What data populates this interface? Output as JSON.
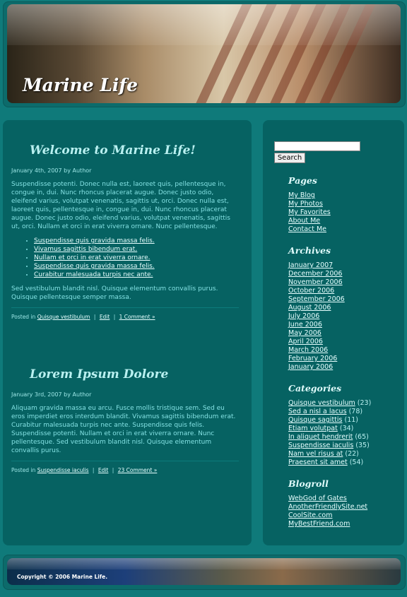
{
  "site": {
    "title": "Marine Life"
  },
  "search": {
    "button_label": "Search",
    "value": ""
  },
  "posts": [
    {
      "title": "Welcome to Marine Life!",
      "meta": "January 4th, 2007 by Author",
      "body_intro": "Suspendisse potenti. Donec nulla est, laoreet quis, pellentesque in, congue in, dui. Nunc rhoncus placerat augue. Donec justo odio, eleifend varius, volutpat venenatis, sagittis ut, orci. Donec nulla est, laoreet quis, pellentesque in, congue in, dui. Nunc rhoncus placerat augue. Donec justo odio, eleifend varius, volutpat venenatis, sagittis ut, orci. Nullam et orci in erat viverra ornare. Nunc pellentesque.",
      "list": [
        "Suspendisse quis gravida massa felis.",
        "Vivamus sagittis bibendum erat.",
        "Nullam et orci in erat viverra ornare.",
        "Suspendisse quis gravida massa felis.",
        "Curabitur malesuada turpis nec ante."
      ],
      "body_outro": "Sed vestibulum blandit nisl. Quisque elementum convallis purus. Quisque pellentesque semper massa.",
      "posted_in_label": "Posted in",
      "category": "Quisque vestibulum",
      "edit_label": "Edit",
      "comments_label": "1 Comment »"
    },
    {
      "title": "Lorem Ipsum Dolore",
      "meta": "January 3rd, 2007 by Author",
      "body_intro": "Aliquam gravida massa eu arcu. Fusce mollis tristique sem. Sed eu eros imperdiet eros interdum blandit. Vivamus sagittis bibendum erat. Curabitur malesuada turpis nec ante. Suspendisse quis felis. Suspendisse potenti. Nullam et orci in erat viverra ornare. Nunc pellentesque. Sed vestibulum blandit nisl. Quisque elementum convallis purus.",
      "posted_in_label": "Posted in",
      "category": "Suspendisse iaculis",
      "edit_label": "Edit",
      "comments_label": "23 Comment »"
    }
  ],
  "sidebar": {
    "pages": {
      "heading": "Pages",
      "items": [
        "My Blog",
        "My Photos",
        "My Favorites",
        "About Me",
        "Contact Me"
      ]
    },
    "archives": {
      "heading": "Archives",
      "items": [
        "January 2007",
        "December 2006",
        "November 2006",
        "October 2006",
        "September 2006",
        "August 2006",
        "July 2006",
        "June 2006",
        "May 2006",
        "April 2006",
        "March 2006",
        "February 2006",
        "January 2006"
      ]
    },
    "categories": {
      "heading": "Categories",
      "items": [
        {
          "name": "Quisque vestibulum",
          "count": "(23)"
        },
        {
          "name": "Sed a nisl a lacus",
          "count": "(78)"
        },
        {
          "name": "Quisque sagittis",
          "count": "(11)"
        },
        {
          "name": "Etiam volutpat",
          "count": "(34)"
        },
        {
          "name": "In aliquet hendrerit",
          "count": "(65)"
        },
        {
          "name": "Suspendisse iaculis",
          "count": "(35)"
        },
        {
          "name": "Nam vel risus at",
          "count": "(22)"
        },
        {
          "name": "Praesent sit amet",
          "count": "(54)"
        }
      ]
    },
    "blogroll": {
      "heading": "Blogroll",
      "items": [
        "WebGod of Gates",
        "AnotherFriendlySite.net",
        "CoolSite.com",
        "MyBestFriend.com"
      ]
    }
  },
  "footer": {
    "copyright": "Copyright © 2006 Marine Life."
  }
}
